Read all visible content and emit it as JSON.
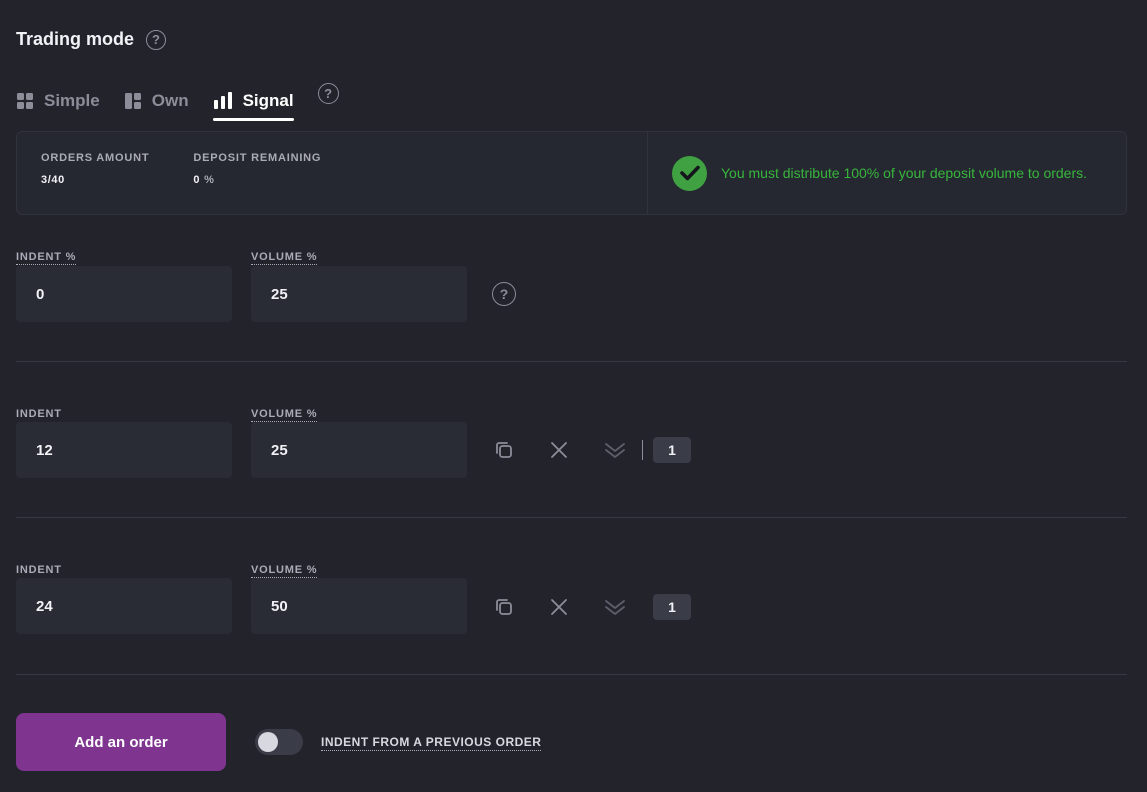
{
  "header": {
    "title": "Trading mode"
  },
  "tabs": [
    {
      "label": "Simple",
      "icon": "grid-icon",
      "active": false
    },
    {
      "label": "Own",
      "icon": "layout-icon",
      "active": false
    },
    {
      "label": "Signal",
      "icon": "bar-chart-icon",
      "active": true
    }
  ],
  "summary": {
    "orders_amount_label": "ORDERS AMOUNT",
    "orders_amount_value": "3/40",
    "deposit_remaining_label": "DEPOSIT REMAINING",
    "deposit_remaining_value": "0",
    "deposit_remaining_unit": "%",
    "message": "You must distribute 100% of your deposit volume to orders.",
    "message_color": "#37b63c"
  },
  "orders": [
    {
      "indent_label": "INDENT %",
      "indent_value": "0",
      "volume_label": "VOLUME %",
      "volume_value": "25"
    },
    {
      "indent_label": "INDENT",
      "indent_value": "12",
      "volume_label": "VOLUME %",
      "volume_value": "25",
      "count": "1"
    },
    {
      "indent_label": "INDENT",
      "indent_value": "24",
      "volume_label": "VOLUME %",
      "volume_value": "50",
      "count": "1"
    }
  ],
  "footer": {
    "add_button_label": "Add an order",
    "add_button_color": "#7f3590",
    "toggle_label": "INDENT FROM A PREVIOUS ORDER",
    "toggle_on": false
  },
  "colors": {
    "background": "#22232b",
    "input_bg": "#2a2c35",
    "muted": "#8b8d99"
  }
}
